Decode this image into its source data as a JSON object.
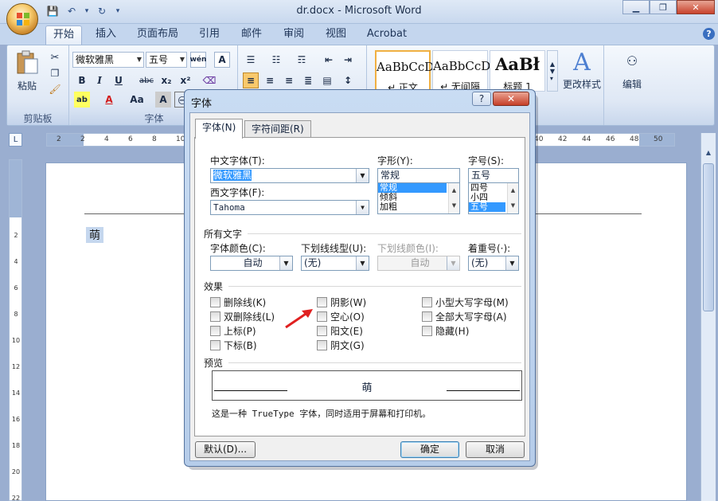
{
  "window": {
    "title": "dr.docx - Microsoft Word",
    "minimize_glyph": "▁",
    "restore_glyph": "❐",
    "close_glyph": "✕"
  },
  "qat": {
    "save_glyph": "💾",
    "undo_glyph": "↶",
    "undo_arrow": "▾",
    "redo_glyph": "↻",
    "customize_glyph": "▾"
  },
  "tabs": [
    "开始",
    "插入",
    "页面布局",
    "引用",
    "邮件",
    "审阅",
    "视图",
    "Acrobat"
  ],
  "help_glyph": "?",
  "ribbon": {
    "clipboard": {
      "label": "剪贴板",
      "paste": "粘贴"
    },
    "font": {
      "label": "字体",
      "font_name": "微软雅黑",
      "font_size": "五号",
      "phonetic": "wén",
      "bold": "B",
      "italic": "I",
      "underline": "U",
      "strike": "abc",
      "subscript": "x₂",
      "superscript": "x²",
      "case": "Aa",
      "border_char": "A",
      "color_a": "A",
      "char_shade": "A"
    },
    "styles": {
      "items": [
        {
          "sample": "AaBbCcD",
          "name": "↵ 正文"
        },
        {
          "sample": "AaBbCcD",
          "name": "↵ 无间隔"
        },
        {
          "sample": "AaBł",
          "name": "标题 1"
        }
      ],
      "change_styles": "更改样式"
    },
    "editing": {
      "label": "编辑"
    }
  },
  "ruler": {
    "corner": "L",
    "ticks": [
      "2",
      "2",
      "4",
      "6",
      "8",
      "10",
      "12",
      "14",
      "16",
      "18",
      "20",
      "22",
      "24",
      "26",
      "28",
      "30",
      "32",
      "34",
      "36",
      "38",
      "40",
      "42",
      "44",
      "46",
      "48",
      "50"
    ],
    "vticks": [
      "2",
      "4",
      "6",
      "8",
      "10",
      "12",
      "14",
      "16",
      "18",
      "20",
      "22"
    ]
  },
  "document": {
    "text": "萌"
  },
  "dialog": {
    "title": "字体",
    "help": "?",
    "close": "✕",
    "tabs": [
      "字体(N)",
      "字符间距(R)"
    ],
    "cn_font_label": "中文字体(T):",
    "cn_font_value": "微软雅黑",
    "west_font_label": "西文字体(F):",
    "west_font_value": "Tahoma",
    "style_label": "字形(Y):",
    "style_value": "常规",
    "style_options": [
      "常规",
      "倾斜",
      "加粗"
    ],
    "size_label": "字号(S):",
    "size_value": "五号",
    "size_options": [
      "四号",
      "小四",
      "五号"
    ],
    "all_text_label": "所有文字",
    "font_color_label": "字体颜色(C):",
    "font_color_value": "自动",
    "underline_type_label": "下划线线型(U):",
    "underline_type_value": "(无)",
    "underline_color_label": "下划线颜色(I):",
    "underline_color_value": "自动",
    "emphasis_label": "着重号(·):",
    "emphasis_value": "(无)",
    "effects_label": "效果",
    "effects": {
      "strikethrough": "删除线(K)",
      "double_strikethrough": "双删除线(L)",
      "superscript": "上标(P)",
      "subscript": "下标(B)",
      "shadow": "阴影(W)",
      "outline": "空心(O)",
      "emboss": "阳文(E)",
      "engrave": "阴文(G)",
      "small_caps": "小型大写字母(M)",
      "all_caps": "全部大写字母(A)",
      "hidden": "隐藏(H)"
    },
    "preview_label": "预览",
    "preview_text": "萌",
    "description": "这是一种 TrueType 字体，同时适用于屏幕和打印机。",
    "default_button": "默认(D)...",
    "ok_button": "确定",
    "cancel_button": "取消"
  },
  "watermark": {
    "brand": "Bai 经验",
    "url": "jingyan.baidu.com"
  },
  "colors": {
    "accent": "#3399ff",
    "annotation_arrow": "#e02020"
  }
}
